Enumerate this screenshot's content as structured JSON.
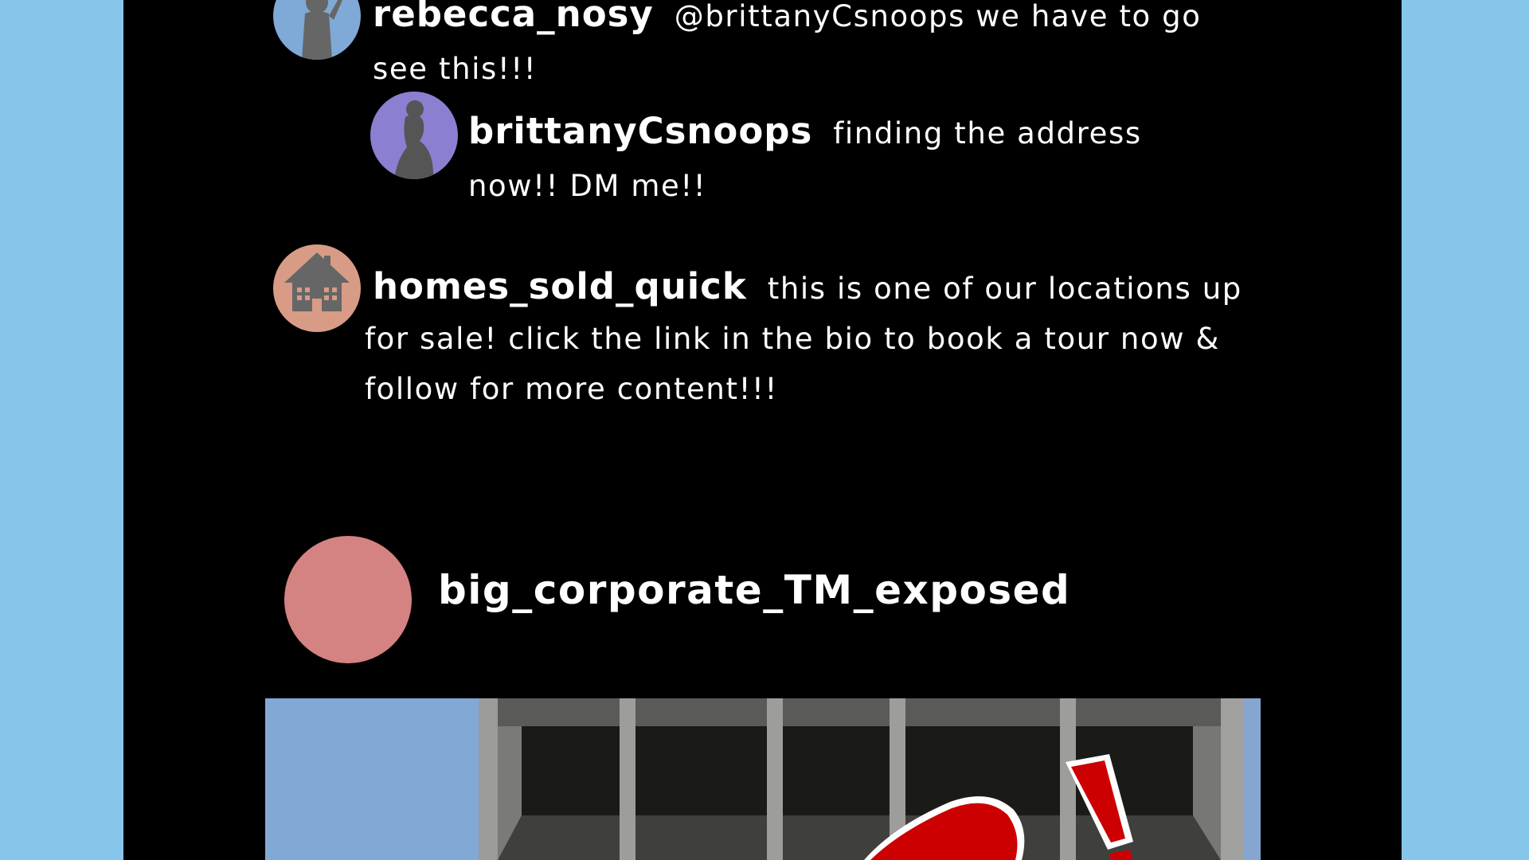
{
  "comments": [
    {
      "username": "rebecca_nosy",
      "text_line1": "@brittanyCsnoops we have to go",
      "text_line2": "see this!!!",
      "avatar_color": "#7fa9d6",
      "avatar_icon": "woman-silhouette-icon"
    },
    {
      "username": "brittanyCsnoops",
      "text_line1": "finding the address",
      "text_line2": "now!! DM me!!",
      "avatar_color": "#8a7fd0",
      "avatar_icon": "woman-profile-silhouette-icon"
    },
    {
      "username": "homes_sold_quick",
      "text_line1": "this is one of our locations up",
      "text_line2": "for sale! click the link in the bio to book a tour now &",
      "text_line3": "follow for more content!!!",
      "avatar_color": "#d89c86",
      "avatar_icon": "house-icon"
    }
  ],
  "post": {
    "username": "big_corporate_TM_exposed",
    "avatar_color": "#d48282",
    "image_icon": "storefront-image",
    "stamp_color": "#cc0000"
  },
  "colors": {
    "page_background": "#86c6ea",
    "panel_background": "#000000",
    "text": "#ffffff"
  }
}
